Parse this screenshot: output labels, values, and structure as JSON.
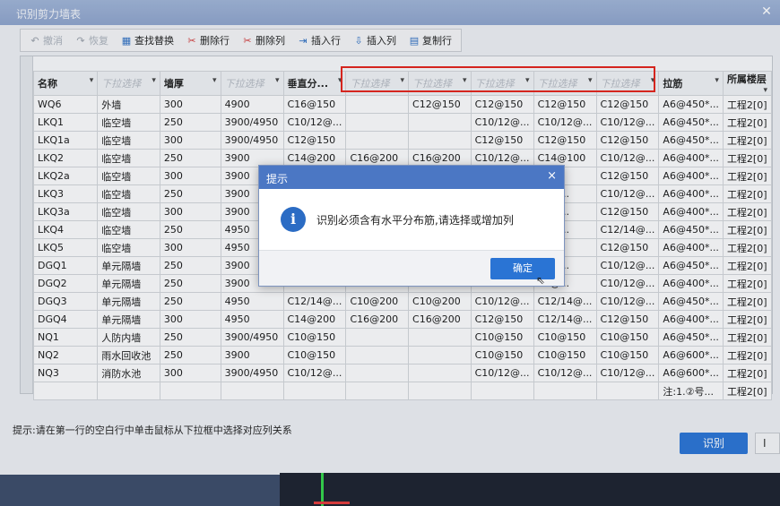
{
  "window": {
    "title": "识别剪力墙表"
  },
  "toolbar": [
    {
      "name": "undo-button",
      "icon": "undo-icon",
      "glyph": "↶",
      "label": "撤消",
      "disabled": true
    },
    {
      "name": "redo-button",
      "icon": "redo-icon",
      "glyph": "↷",
      "label": "恢复",
      "disabled": true
    },
    {
      "name": "find-replace-button",
      "icon": "find-replace-icon",
      "glyph": "▦",
      "label": "查找替换",
      "disabled": false
    },
    {
      "name": "delete-row-button",
      "icon": "delete-row-icon",
      "glyph": "✂",
      "label": "删除行",
      "disabled": false
    },
    {
      "name": "delete-column-button",
      "icon": "delete-column-icon",
      "glyph": "✂",
      "label": "删除列",
      "disabled": false
    },
    {
      "name": "insert-row-button",
      "icon": "insert-row-icon",
      "glyph": "⇥",
      "label": "插入行",
      "disabled": false
    },
    {
      "name": "insert-column-button",
      "icon": "insert-column-icon",
      "glyph": "⇩",
      "label": "插入列",
      "disabled": false
    },
    {
      "name": "copy-row-button",
      "icon": "copy-row-icon",
      "glyph": "▤",
      "label": "复制行",
      "disabled": false
    }
  ],
  "table": {
    "headers": [
      {
        "label": "名称",
        "dropdown": false
      },
      {
        "label": "下拉选择",
        "dropdown": true
      },
      {
        "label": "墙厚",
        "dropdown": false
      },
      {
        "label": "下拉选择",
        "dropdown": true
      },
      {
        "label": "垂直分...",
        "dropdown": false
      },
      {
        "label": "下拉选择",
        "dropdown": true
      },
      {
        "label": "下拉选择",
        "dropdown": true
      },
      {
        "label": "下拉选择",
        "dropdown": true
      },
      {
        "label": "下拉选择",
        "dropdown": true
      },
      {
        "label": "下拉选择",
        "dropdown": true
      },
      {
        "label": "拉筋",
        "dropdown": false
      },
      {
        "label": "所属楼层",
        "dropdown": false
      }
    ],
    "rows": [
      [
        "WQ6",
        "外墙",
        "300",
        "4900",
        "C16@150",
        "",
        "C12@150",
        "C12@150",
        "C12@150",
        "C12@150",
        "A6@450*...",
        "工程2[0]"
      ],
      [
        "LKQ1",
        "临空墙",
        "250",
        "3900/4950",
        "C10/12@...",
        "",
        "",
        "C10/12@...",
        "C10/12@...",
        "C10/12@...",
        "A6@450*...",
        "工程2[0]"
      ],
      [
        "LKQ1a",
        "临空墙",
        "300",
        "3900/4950",
        "C12@150",
        "",
        "",
        "C12@150",
        "C12@150",
        "C12@150",
        "A6@450*...",
        "工程2[0]"
      ],
      [
        "LKQ2",
        "临空墙",
        "250",
        "3900",
        "C14@200",
        "C16@200",
        "C16@200",
        "C10/12@...",
        "C14@100",
        "C10/12@...",
        "A6@400*...",
        "工程2[0]"
      ],
      [
        "LKQ2a",
        "临空墙",
        "300",
        "3900",
        "",
        "",
        "",
        "",
        "100",
        "C12@150",
        "A6@400*...",
        "工程2[0]"
      ],
      [
        "LKQ3",
        "临空墙",
        "250",
        "3900",
        "",
        "",
        "",
        "",
        "14@...",
        "C10/12@...",
        "A6@400*...",
        "工程2[0]"
      ],
      [
        "LKQ3a",
        "临空墙",
        "300",
        "3900",
        "",
        "",
        "",
        "",
        "12@...",
        "C12@150",
        "A6@400*...",
        "工程2[0]"
      ],
      [
        "LKQ4",
        "临空墙",
        "250",
        "4950",
        "",
        "",
        "",
        "",
        "12@...",
        "C12/14@...",
        "A6@450*...",
        "工程2[0]"
      ],
      [
        "LKQ5",
        "临空墙",
        "300",
        "4950",
        "",
        "",
        "",
        "",
        "100",
        "C12@150",
        "A6@400*...",
        "工程2[0]"
      ],
      [
        "DGQ1",
        "单元隔墙",
        "250",
        "3900",
        "",
        "",
        "",
        "",
        "12@...",
        "C10/12@...",
        "A6@450*...",
        "工程2[0]"
      ],
      [
        "DGQ2",
        "单元隔墙",
        "250",
        "3900",
        "",
        "",
        "",
        "",
        "12@...",
        "C10/12@...",
        "A6@400*...",
        "工程2[0]"
      ],
      [
        "DGQ3",
        "单元隔墙",
        "250",
        "4950",
        "C12/14@...",
        "C10@200",
        "C10@200",
        "C10/12@...",
        "C12/14@...",
        "C10/12@...",
        "A6@450*...",
        "工程2[0]"
      ],
      [
        "DGQ4",
        "单元隔墙",
        "300",
        "4950",
        "C14@200",
        "C16@200",
        "C16@200",
        "C12@150",
        "C12/14@...",
        "C12@150",
        "A6@400*...",
        "工程2[0]"
      ],
      [
        "NQ1",
        "人防内墙",
        "250",
        "3900/4950",
        "C10@150",
        "",
        "",
        "C10@150",
        "C10@150",
        "C10@150",
        "A6@450*...",
        "工程2[0]"
      ],
      [
        "NQ2",
        "雨水回收池",
        "250",
        "3900",
        "C10@150",
        "",
        "",
        "C10@150",
        "C10@150",
        "C10@150",
        "A6@600*...",
        "工程2[0]"
      ],
      [
        "NQ3",
        "消防水池",
        "300",
        "3900/4950",
        "C10/12@...",
        "",
        "",
        "C10/12@...",
        "C10/12@...",
        "C10/12@...",
        "A6@600*...",
        "工程2[0]"
      ],
      [
        "",
        "",
        "",
        "",
        "",
        "",
        "",
        "",
        "",
        "",
        "注:1.②号...",
        "工程2[0]"
      ]
    ]
  },
  "hint": "提示:请在第一行的空白行中单击鼠标从下拉框中选择对应列关系",
  "footer": {
    "recognize_label": "识别",
    "cancel_stub": "I"
  },
  "dialog": {
    "title": "提示",
    "message": "识别必须含有水平分布筋,请选择或增加列",
    "ok_label": "确定",
    "close_glyph": "×",
    "icon": "info-icon"
  },
  "colors": {
    "accent": "#2a74d4",
    "dialog_title": "#4b77c4",
    "highlight_border": "#e3231b"
  }
}
